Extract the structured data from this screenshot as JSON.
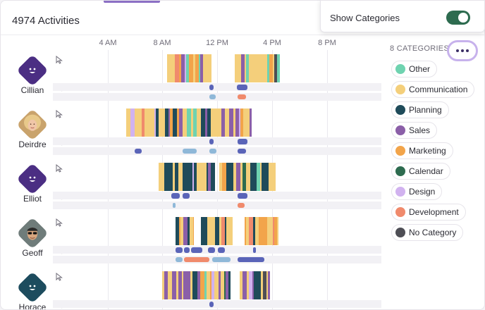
{
  "header": {
    "title": "4974 Activities"
  },
  "timeline": {
    "ticks": [
      "4 AM",
      "8 AM",
      "12 PM",
      "4 PM",
      "8 PM"
    ]
  },
  "popup": {
    "label": "Show Categories",
    "enabled": true
  },
  "categories": {
    "count_label": "8 CATEGORIES",
    "items": [
      {
        "label": "Other",
        "color": "#6fd3b0"
      },
      {
        "label": "Communication",
        "color": "#f4cf7b"
      },
      {
        "label": "Planning",
        "color": "#1f4b5a"
      },
      {
        "label": "Sales",
        "color": "#8b5fa8"
      },
      {
        "label": "Marketing",
        "color": "#f2a44a"
      },
      {
        "label": "Calendar",
        "color": "#2d6b4f"
      },
      {
        "label": "Design",
        "color": "#d1b2ef"
      },
      {
        "label": "Development",
        "color": "#f08a6c"
      },
      {
        "label": "No Category",
        "color": "#4e4e55"
      }
    ]
  },
  "people": [
    {
      "name": "Cillian",
      "avatar": "purple-smiley"
    },
    {
      "name": "Deirdre",
      "avatar": "photo-blonde"
    },
    {
      "name": "Elliot",
      "avatar": "purple-smiley"
    },
    {
      "name": "Geoff",
      "avatar": "photo-sunglasses"
    },
    {
      "name": "Horace",
      "avatar": "teal-smiley"
    }
  ],
  "icons": {
    "activity": "cursor-icon",
    "calls": "phone-icon",
    "meetings": "calendar-icon",
    "more": "more-dots-icon"
  }
}
